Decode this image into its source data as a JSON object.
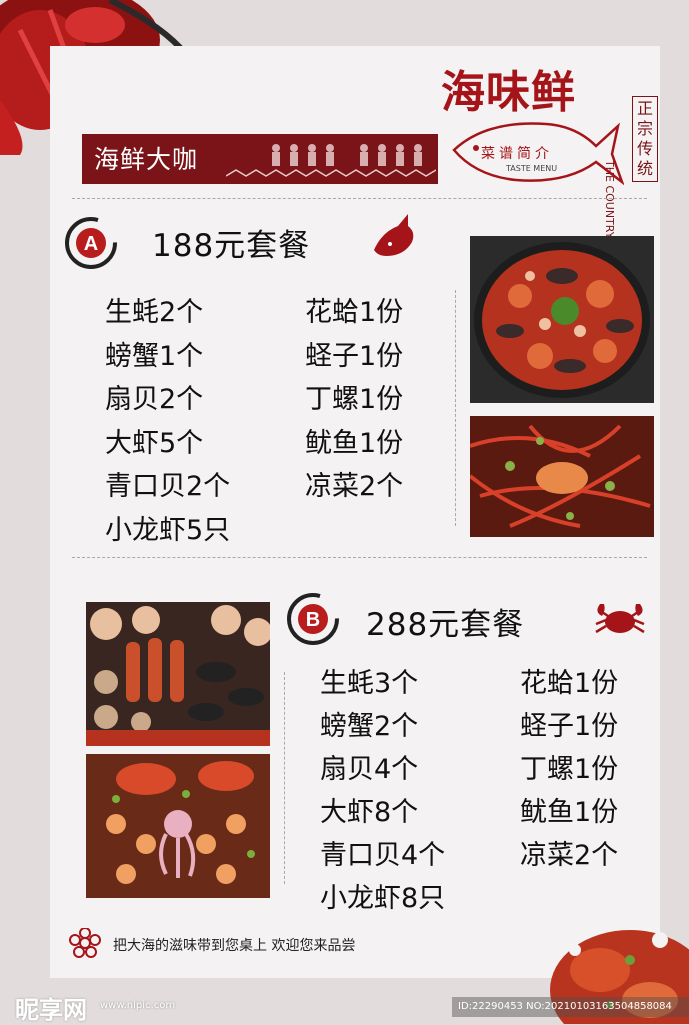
{
  "brand": {
    "title": "海味鲜",
    "vertical_text": "正宗传统",
    "english_text": "THE COUNTRY",
    "menu_intro": "菜谱简介",
    "taste_menu": "TASTE MENU"
  },
  "banner": {
    "text": "海鲜大咖"
  },
  "set_a": {
    "badge": "A",
    "title": "188元套餐",
    "left_items": [
      "生蚝2个",
      "螃蟹1个",
      "扇贝2个",
      "大虾5个",
      "青口贝2个",
      "小龙虾5只"
    ],
    "right_items": [
      "花蛤1份",
      "蛏子1份",
      "丁螺1份",
      "鱿鱼1份",
      "凉菜2个"
    ]
  },
  "set_b": {
    "badge": "B",
    "title": "288元套餐",
    "left_items": [
      "生蚝3个",
      "螃蟹2个",
      "扇贝4个",
      "大虾8个",
      "青口贝4个",
      "小龙虾8只"
    ],
    "right_items": [
      "花蛤1份",
      "蛏子1份",
      "丁螺1份",
      "鱿鱼1份",
      "凉菜2个"
    ]
  },
  "footer": {
    "slogan": "把大海的滋味带到您桌上  欢迎您来品尝"
  },
  "watermark": {
    "site": "昵享网",
    "url": "www.nipic.com",
    "id": "ID:22290453 NO:20210103163504858084"
  },
  "colors": {
    "brand_red": "#a41418",
    "banner_bg": "#7a1418",
    "panel_bg": "#f4f2f2",
    "page_bg": "#e3dcdc"
  }
}
